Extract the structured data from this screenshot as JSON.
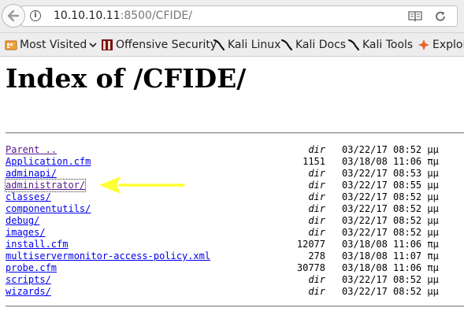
{
  "browser": {
    "url_host": "10.10.10.11",
    "url_rest": ":8500/CFIDE/",
    "info_glyph": "i"
  },
  "bookmarks": [
    {
      "label": "Most Visited",
      "icon": "most-visited-icon"
    },
    {
      "label": "Offensive Security",
      "icon": "offsec-icon"
    },
    {
      "label": "Kali Linux",
      "icon": "kali-dragon-icon"
    },
    {
      "label": "Kali Docs",
      "icon": "kali-dragon-icon"
    },
    {
      "label": "Kali Tools",
      "icon": "kali-dragon-icon"
    },
    {
      "label": "Exploit",
      "icon": "exploit-db-icon"
    }
  ],
  "page": {
    "title": "Index of /CFIDE/"
  },
  "listing": [
    {
      "name": "Parent ..",
      "size": "dir",
      "date": "03/22/17 08:52 μμ"
    },
    {
      "name": "Application.cfm",
      "size": "1151",
      "date": "03/18/08 11:06 πμ"
    },
    {
      "name": "adminapi/",
      "size": "dir",
      "date": "03/22/17 08:53 μμ"
    },
    {
      "name": "administrator/",
      "size": "dir",
      "date": "03/22/17 08:55 μμ"
    },
    {
      "name": "classes/",
      "size": "dir",
      "date": "03/22/17 08:52 μμ"
    },
    {
      "name": "componentutils/",
      "size": "dir",
      "date": "03/22/17 08:52 μμ"
    },
    {
      "name": "debug/",
      "size": "dir",
      "date": "03/22/17 08:52 μμ"
    },
    {
      "name": "images/",
      "size": "dir",
      "date": "03/22/17 08:52 μμ"
    },
    {
      "name": "install.cfm",
      "size": "12077",
      "date": "03/18/08 11:06 πμ"
    },
    {
      "name": "multiservermonitor-access-policy.xml",
      "size": "278",
      "date": "03/18/08 11:07 πμ"
    },
    {
      "name": "probe.cfm",
      "size": "30778",
      "date": "03/18/08 11:06 πμ"
    },
    {
      "name": "scripts/",
      "size": "dir",
      "date": "03/22/17 08:52 μμ"
    },
    {
      "name": "wizards/",
      "size": "dir",
      "date": "03/22/17 08:52 μμ"
    }
  ],
  "annotation": {
    "arrow_color": "#ffff33",
    "points_to": "administrator/"
  }
}
